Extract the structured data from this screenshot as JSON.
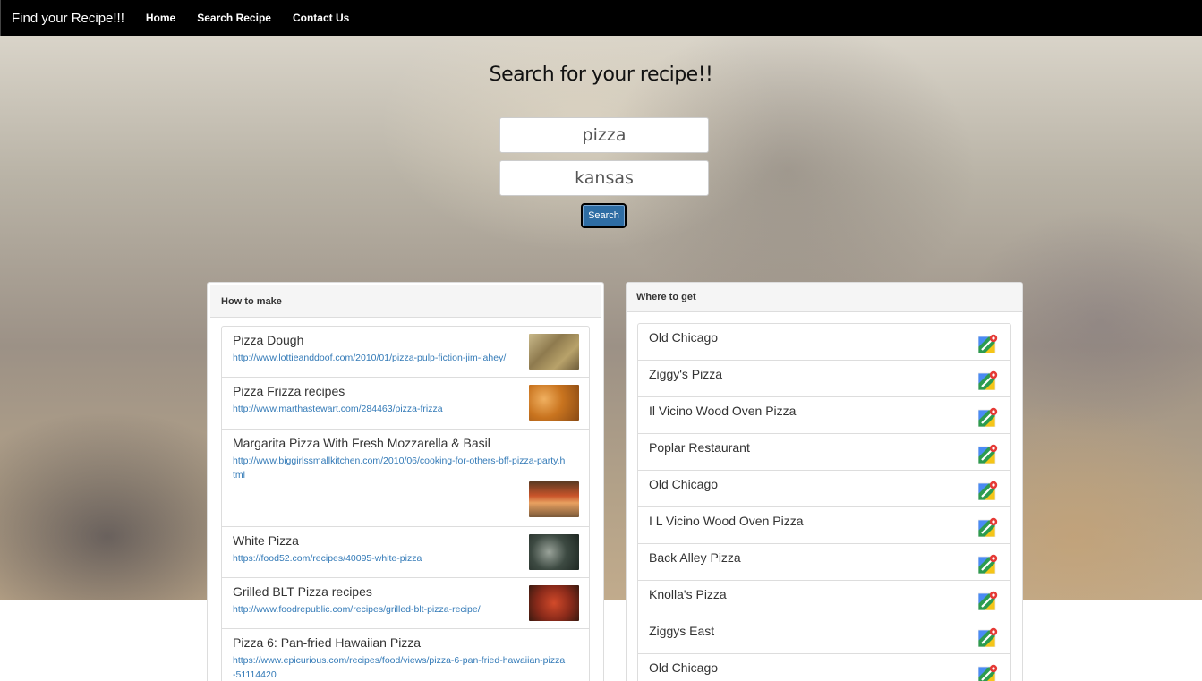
{
  "navbar": {
    "brand": "Find your Recipe!!!",
    "links": [
      "Home",
      "Search Recipe",
      "Contact Us"
    ]
  },
  "search": {
    "title": "Search for your recipe!!",
    "query": "pizza",
    "location": "kansas",
    "button_label": "Search"
  },
  "recipes_panel": {
    "heading": "How to make",
    "items": [
      {
        "title": "Pizza Dough",
        "url": "http://www.lottieanddoof.com/2010/01/pizza-pulp-fiction-jim-lahey/"
      },
      {
        "title": "Pizza Frizza recipes",
        "url": "http://www.marthastewart.com/284463/pizza-frizza"
      },
      {
        "title": "Margarita Pizza With Fresh Mozzarella & Basil",
        "url": "http://www.biggirlssmallkitchen.com/2010/06/cooking-for-others-bff-pizza-party.html"
      },
      {
        "title": "White Pizza",
        "url": "https://food52.com/recipes/40095-white-pizza"
      },
      {
        "title": "Grilled BLT Pizza recipes",
        "url": "http://www.foodrepublic.com/recipes/grilled-blt-pizza-recipe/"
      },
      {
        "title": "Pizza 6: Pan-fried Hawaiian Pizza",
        "url": "https://www.epicurious.com/recipes/food/views/pizza-6-pan-fried-hawaiian-pizza-51114420"
      }
    ]
  },
  "places_panel": {
    "heading": "Where to get",
    "items": [
      "Old Chicago",
      "Ziggy's Pizza",
      "Il Vicino Wood Oven Pizza",
      "Poplar Restaurant",
      "Old Chicago",
      "I L Vicino Wood Oven Pizza",
      "Back Alley Pizza",
      "Knolla's Pizza",
      "Ziggys East",
      "Old Chicago"
    ]
  }
}
